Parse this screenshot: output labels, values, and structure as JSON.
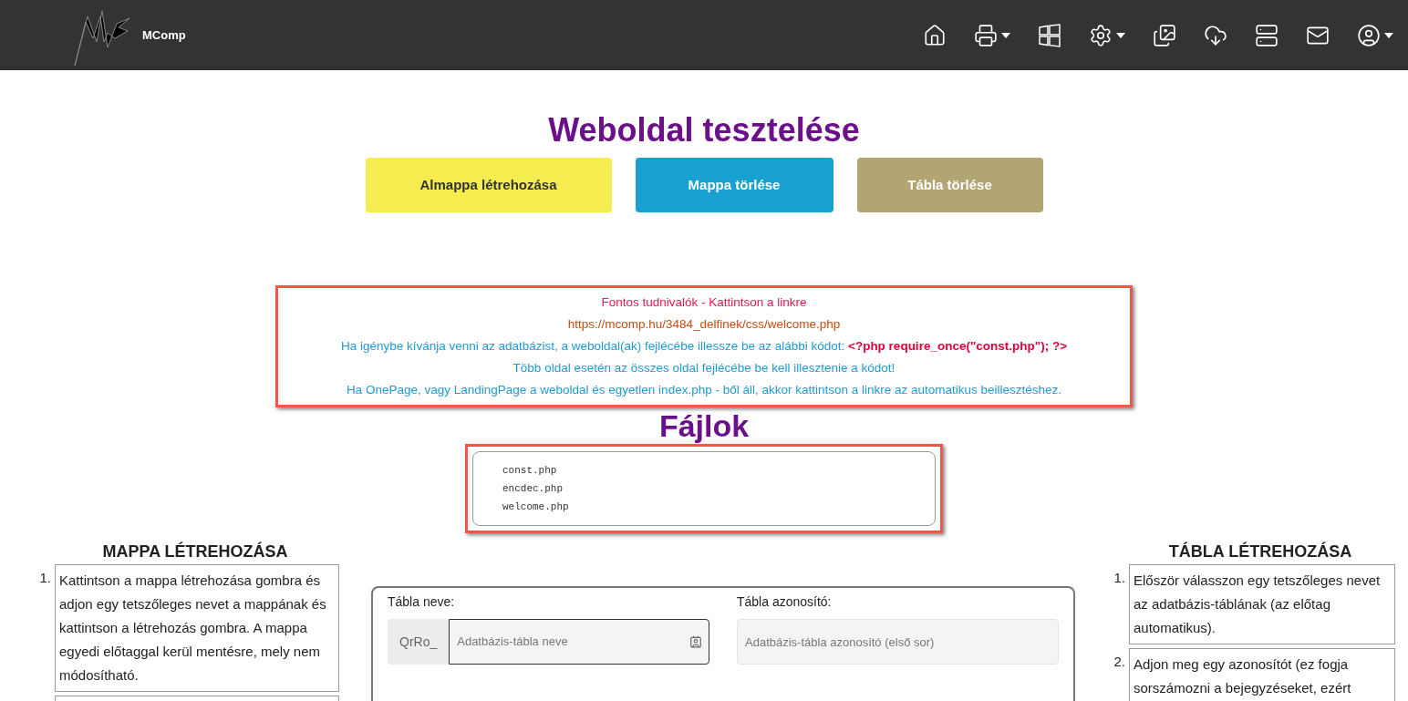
{
  "header": {
    "brand": "MComp"
  },
  "title": "Weboldal tesztelése",
  "actions": [
    {
      "label": "Almappa létrehozása",
      "color": "#f5ec4f"
    },
    {
      "label": "Mappa törlése",
      "color": "#18a0d0"
    },
    {
      "label": "Tábla törlése",
      "color": "#b3a573"
    }
  ],
  "notice": [
    {
      "kind": "title",
      "text": "Fontos tudnivalók - Kattintson a linkre"
    },
    {
      "kind": "link",
      "text": "https://mcomp.hu/3484_delfinek/css/welcome.php"
    },
    {
      "kind": "text",
      "text": "Ha igénybe kívánja venni az adatbázist, a weboldal(ak) fejlécébe illessze be az alábbi kódot: **<?php require_once(\"const.php\"); ?>**"
    },
    {
      "kind": "text",
      "text": "Több oldal esetén az összes oldal fejlécébe be kell illesztenie a kódot!"
    },
    {
      "kind": "text",
      "text": "Ha OnePage, vagy LandingPage a weboldal és egyetlen index.php - ből áll, akkor kattintson a linkre az automatikus beillesztéshez."
    }
  ],
  "files": {
    "title": "Fájlok",
    "items": [
      "const.php",
      "encdec.php",
      "welcome.php"
    ]
  },
  "folder_help": {
    "title": "MAPPA LÉTREHOZÁSA",
    "steps": [
      {
        "number": "1.",
        "text": "Kattintson a mappa létrehozása gombra és adjon egy tetszőleges nevet a mappának és kattintson a létrehozás gombra. A mappa egyedi előtaggal kerül mentésre, mely nem módosítható."
      },
      {
        "kind": "cut"
      }
    ]
  },
  "table_form": {
    "name_label": "Tábla neve:",
    "prefix": "QrRo_",
    "name_placeholder": "Adatbázis-tábla neve",
    "id_label": "Tábla azonosító:",
    "id_placeholder": "Adatbázis-tábla azonosító (első sor)"
  },
  "table_help": {
    "title": "TÁBLA LÉTREHOZÁSA",
    "steps": [
      {
        "number": "1.",
        "text": "Először válasszon egy tetszőleges nevet az adatbázis-táblának (az előtag automatikus)."
      },
      {
        "number": "2.",
        "text": "Adjon meg egy azonosítót (ez fogja sorszámozni a bejegyzéseket, ezért"
      }
    ]
  }
}
